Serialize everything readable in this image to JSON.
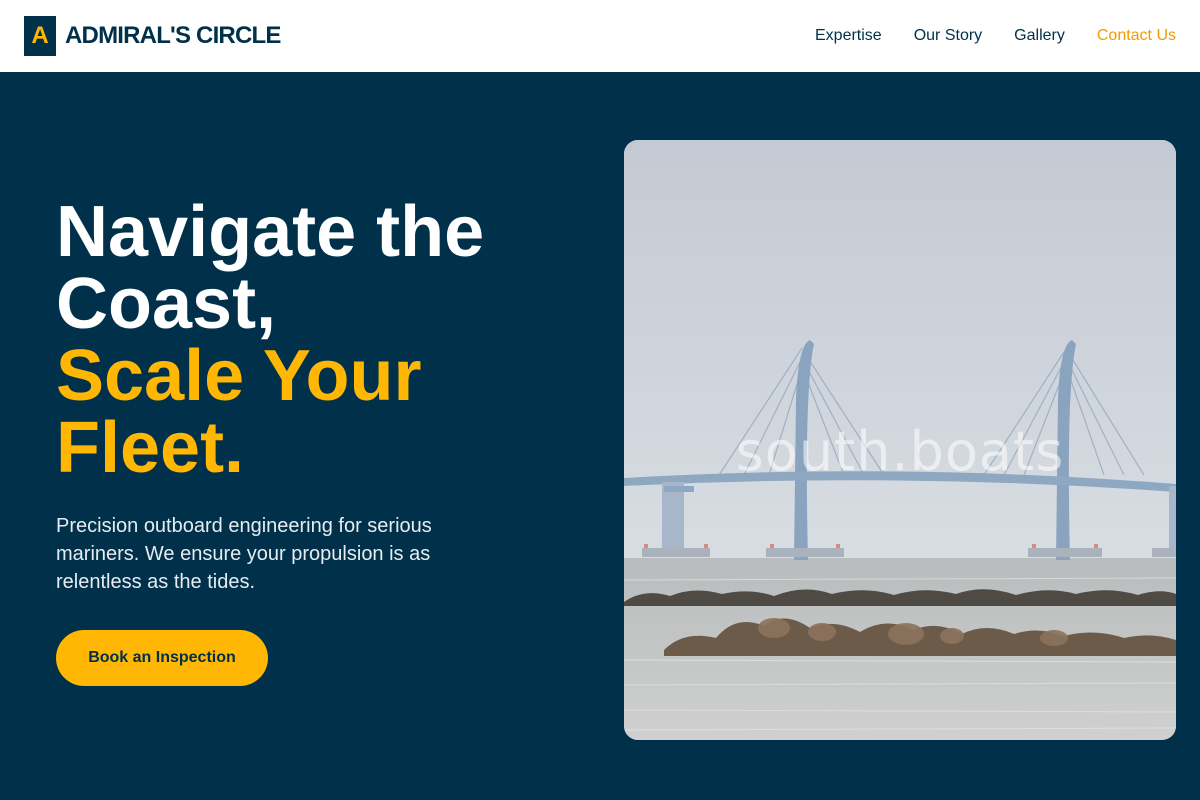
{
  "brand": {
    "mark": "A",
    "name": "ADMIRAL'S CIRCLE"
  },
  "nav": {
    "items": [
      {
        "label": "Expertise"
      },
      {
        "label": "Our Story"
      },
      {
        "label": "Gallery"
      },
      {
        "label": "Contact Us"
      }
    ]
  },
  "hero": {
    "headline_line1": "Navigate the",
    "headline_line2": "Coast,",
    "headline_line3": "Scale Your",
    "headline_line4": "Fleet.",
    "subtext": "Precision outboard engineering for serious mariners. We ensure your propulsion is as relentless as the tides.",
    "cta_label": "Book an Inspection"
  },
  "image": {
    "watermark": "south.boats"
  },
  "colors": {
    "navy": "#00304a",
    "amber": "#ffb703",
    "contact_orange": "#f29a00",
    "white": "#ffffff"
  }
}
